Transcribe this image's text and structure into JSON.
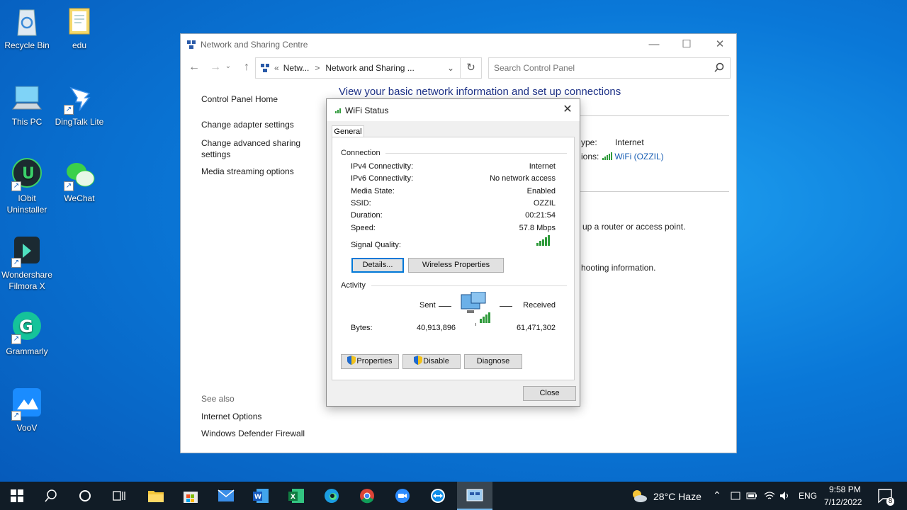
{
  "desktop": {
    "icons": [
      {
        "label": "Recycle Bin"
      },
      {
        "label": "edu"
      },
      {
        "label": "This PC"
      },
      {
        "label": "DingTalk Lite"
      },
      {
        "label": "IObit Uninstaller"
      },
      {
        "label": "WeChat"
      },
      {
        "label": "Wondershare Filmora X"
      },
      {
        "label": "Grammarly"
      },
      {
        "label": "VooV"
      }
    ]
  },
  "explorer": {
    "title": "Network and Sharing Centre",
    "breadcrumb_prefix": "«",
    "breadcrumb_1": "Netw...",
    "breadcrumb_sep": ">",
    "breadcrumb_2": "Network and Sharing ...",
    "search_placeholder": "Search Control Panel",
    "leftnav": {
      "home": "Control Panel Home",
      "adapter": "Change adapter settings",
      "advanced_1": "Change advanced sharing",
      "advanced_2": "settings",
      "media": "Media streaming options",
      "see_also": "See also",
      "internet_options": "Internet Options",
      "firewall": "Windows Defender Firewall"
    },
    "main_title": "View your basic network information and set up connections",
    "bg_access_type_label": "ype:",
    "bg_access_type_value": "Internet",
    "bg_connections_label": "ions:",
    "bg_connection_link": "WiFi (OZZIL)",
    "bg_router_text": "up a router or access point.",
    "bg_trouble_text": "hooting information."
  },
  "dialog": {
    "title": "WiFi Status",
    "tab": "General",
    "connection_label": "Connection",
    "rows": [
      {
        "label": "IPv4 Connectivity:",
        "value": "Internet"
      },
      {
        "label": "IPv6 Connectivity:",
        "value": "No network access"
      },
      {
        "label": "Media State:",
        "value": "Enabled"
      },
      {
        "label": "SSID:",
        "value": "OZZIL"
      },
      {
        "label": "Duration:",
        "value": "00:21:54"
      },
      {
        "label": "Speed:",
        "value": "57.8 Mbps"
      }
    ],
    "signal_label": "Signal Quality:",
    "details_button": "Details...",
    "wireless_button": "Wireless Properties",
    "activity_label": "Activity",
    "sent_label": "Sent",
    "received_label": "Received",
    "bytes_label": "Bytes:",
    "bytes_sent": "40,913,896",
    "bytes_received": "61,471,302",
    "properties_button": "Properties",
    "disable_button": "Disable",
    "diagnose_button": "Diagnose",
    "close_button": "Close"
  },
  "taskbar": {
    "weather": "28°C  Haze",
    "language": "ENG",
    "time": "9:58 PM",
    "date": "7/12/2022",
    "notification_count": "8"
  }
}
